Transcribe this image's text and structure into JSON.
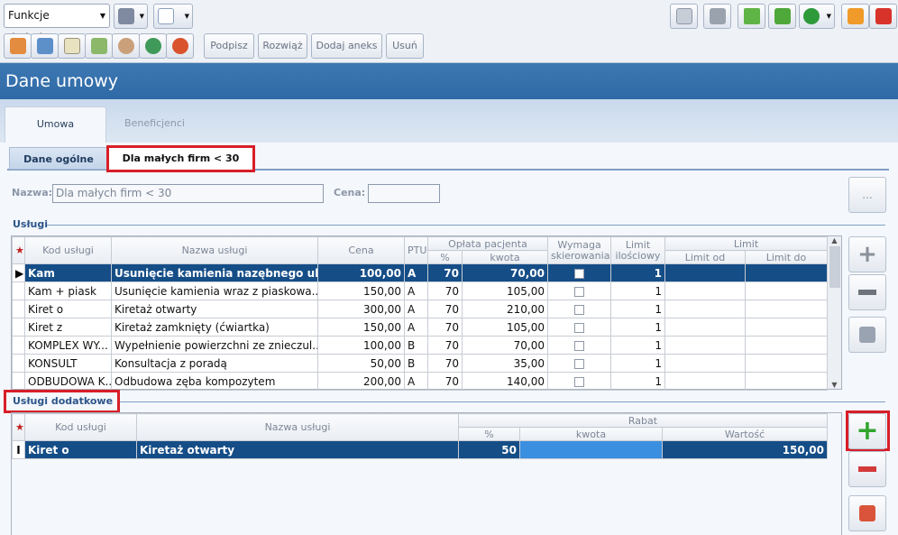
{
  "toolbar": {
    "combo_label": "Funkcje dodatkowe",
    "buttons": {
      "sign": "Podpisz",
      "terminate": "Rozwiąż",
      "annex": "Dodaj aneks",
      "delete": "Usuń"
    }
  },
  "header": {
    "title": "Dane umowy"
  },
  "main_tabs": [
    "Umowa podstawowa",
    "Beneficjenci"
  ],
  "sub_tabs": [
    "Dane ogólne",
    "Dla małych firm < 30"
  ],
  "form": {
    "name_label": "Nazwa:",
    "name_value": "Dla małych firm < 30",
    "price_label": "Cena:",
    "price_value": "",
    "browse_label": "..."
  },
  "services": {
    "section_title": "Usługi",
    "headers": {
      "code": "Kod usługi",
      "name": "Nazwa usługi",
      "price": "Cena",
      "ptu": "PTU",
      "fee": "Opłata pacjenta",
      "fee_pct": "%",
      "fee_amt": "kwota",
      "referral": "Wymaga skierowania",
      "limit_qty": "Limit ilościowy",
      "limit": "Limit",
      "limit_from": "Limit od",
      "limit_to": "Limit do"
    },
    "rows": [
      {
        "code": "Kam",
        "name": "Usunięcie kamienia nazębnego ul...",
        "price": "100,00",
        "ptu": "A",
        "pct": "70",
        "amt": "70,00",
        "qty": "1"
      },
      {
        "code": "Kam + piask",
        "name": "Usunięcie kamienia wraz z piaskowa...",
        "price": "150,00",
        "ptu": "A",
        "pct": "70",
        "amt": "105,00",
        "qty": "1"
      },
      {
        "code": "Kiret o",
        "name": "Kiretaż otwarty",
        "price": "300,00",
        "ptu": "A",
        "pct": "70",
        "amt": "210,00",
        "qty": "1"
      },
      {
        "code": "Kiret z",
        "name": "Kiretaż zamknięty (ćwiartka)",
        "price": "150,00",
        "ptu": "A",
        "pct": "70",
        "amt": "105,00",
        "qty": "1"
      },
      {
        "code": "KOMPLEX WY...",
        "name": "Wypełnienie powierzchni ze znieczul...",
        "price": "100,00",
        "ptu": "B",
        "pct": "70",
        "amt": "70,00",
        "qty": "1"
      },
      {
        "code": "KONSULT",
        "name": "Konsultacja z poradą",
        "price": "50,00",
        "ptu": "B",
        "pct": "70",
        "amt": "35,00",
        "qty": "1"
      },
      {
        "code": "ODBUDOWA K...",
        "name": "Odbudowa zęba kompozytem",
        "price": "200,00",
        "ptu": "A",
        "pct": "70",
        "amt": "140,00",
        "qty": "1"
      }
    ]
  },
  "extra": {
    "section_title": "Usługi dodatkowe",
    "headers": {
      "code": "Kod usługi",
      "name": "Nazwa usługi",
      "discount": "Rabat",
      "pct": "%",
      "amt": "kwota",
      "value": "Wartość"
    },
    "rows": [
      {
        "code": "Kiret o",
        "name": "Kiretaż otwarty",
        "pct": "50",
        "amt": "",
        "value": "150,00"
      }
    ]
  },
  "icons": [
    "mail-icon",
    "printer-settings-icon",
    "back-arrow-icon",
    "up-arrow-icon",
    "help-icon",
    "lock-icon",
    "power-icon",
    "home-icon",
    "calendar-icon",
    "document-icon",
    "clipboard-icon",
    "user-icon",
    "refresh-icon",
    "medical-icon",
    "add-icon",
    "remove-icon",
    "import-icon"
  ]
}
